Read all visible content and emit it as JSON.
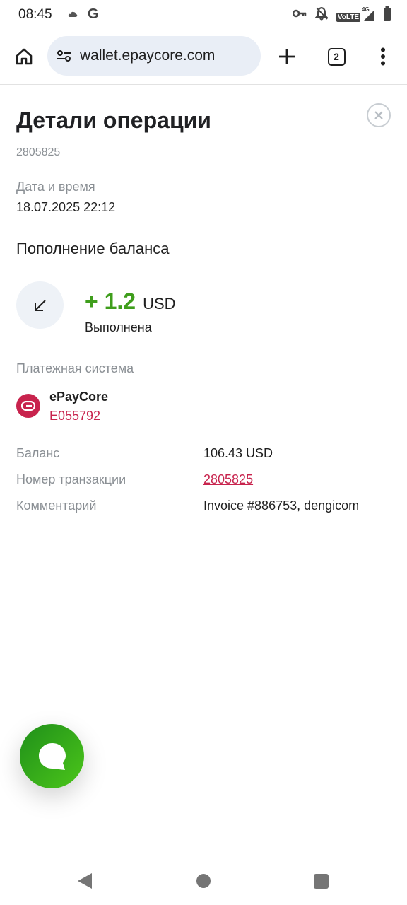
{
  "status_bar": {
    "time": "08:45",
    "left_icons": [
      "cloud-icon",
      "google-icon"
    ],
    "right_icons": [
      "vpn-key-icon",
      "notifications-off-icon",
      "volte-4g-signal-icon",
      "battery-icon"
    ],
    "google_glyph": "G",
    "volte": "VoLTE",
    "network": "4G"
  },
  "browser": {
    "url": "wallet.epaycore.com",
    "tab_count": "2"
  },
  "details": {
    "title": "Детали операции",
    "operation_id": "2805825",
    "datetime_label": "Дата и время",
    "datetime_value": "18.07.2025 22:12",
    "operation_type": "Пополнение баланса",
    "amount_value": "+ 1.2",
    "amount_currency": "USD",
    "status": "Выполнена",
    "payment_system_label": "Платежная система",
    "payment_system_name": "ePayCore",
    "payment_system_account": "E055792",
    "rows": [
      {
        "label": "Баланс",
        "value": "106.43 USD"
      },
      {
        "label": "Номер транзакции",
        "value": "2805825"
      },
      {
        "label": "Комментарий",
        "value": "Invoice #886753, dengicom"
      }
    ]
  },
  "colors": {
    "amount_green": "#3f9e1c",
    "brand_red": "#c8234d",
    "muted_text": "#8a8f94",
    "url_bar_bg": "#e9eef6"
  }
}
